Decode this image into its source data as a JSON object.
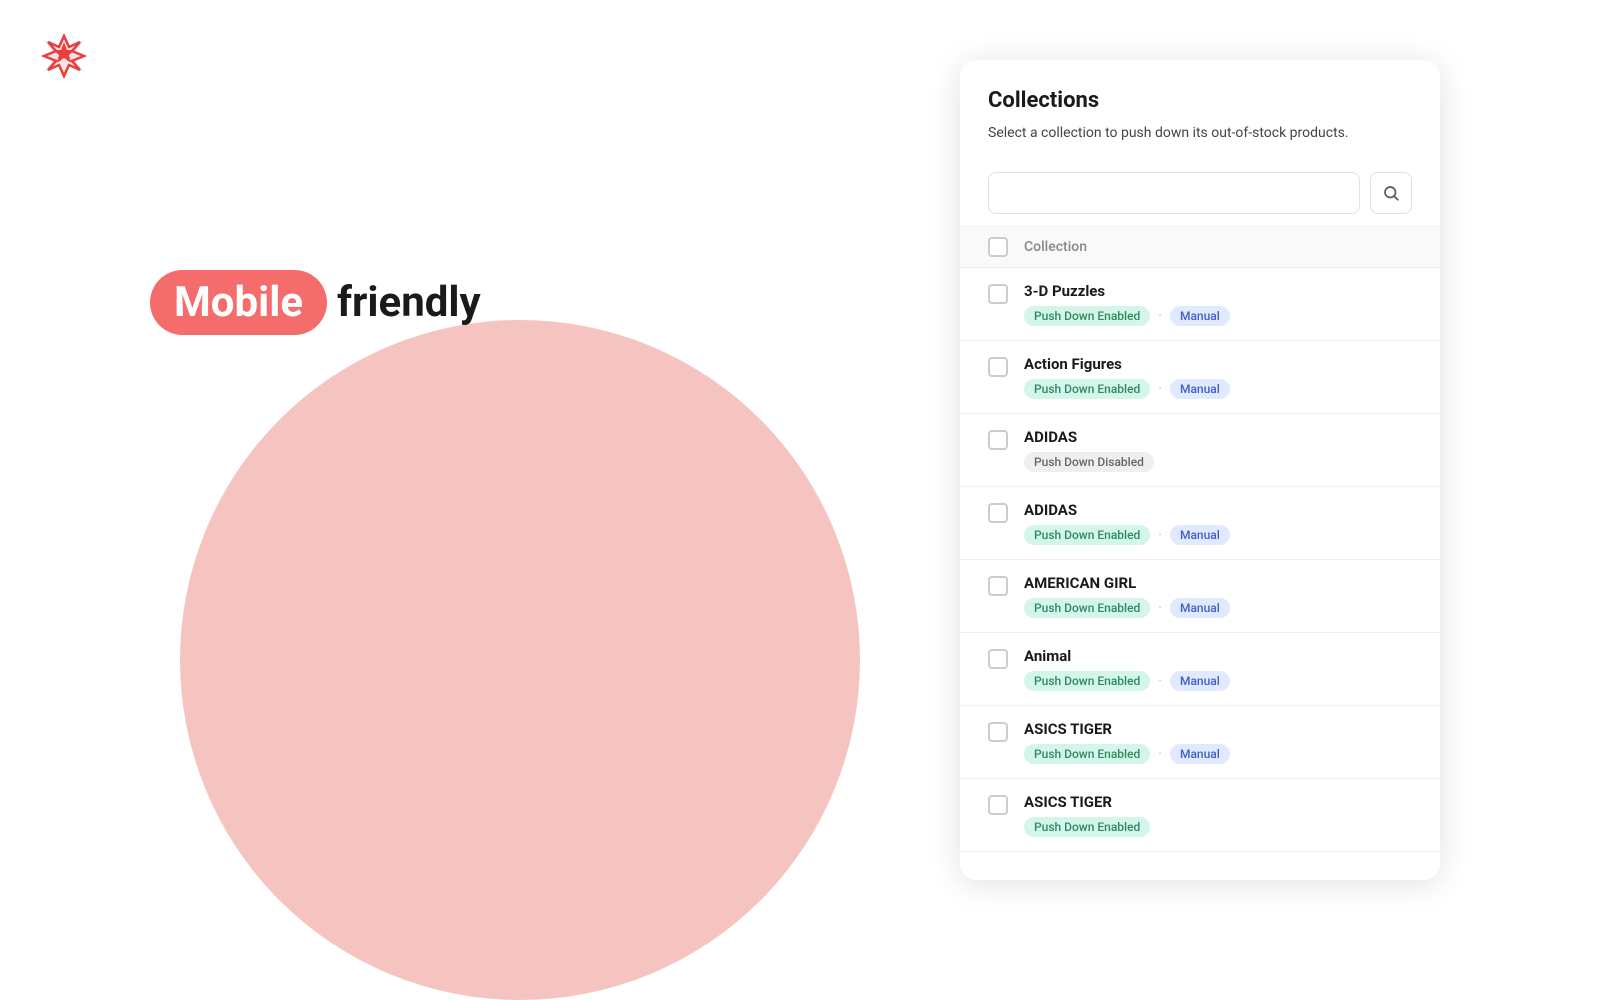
{
  "logo": {
    "alt": "App Logo"
  },
  "hero": {
    "mobile_label": "Mobile",
    "friendly_label": "friendly"
  },
  "panel": {
    "title": "Collections",
    "subtitle": "Select a collection to push down its out-of-stock products.",
    "search_placeholder": "",
    "table_header": "Collection",
    "collections": [
      {
        "id": 1,
        "name": "3-D Puzzles",
        "push_down": "Push Down Enabled",
        "push_down_type": "green",
        "mode": "Manual",
        "mode_type": "blue"
      },
      {
        "id": 2,
        "name": "Action Figures",
        "push_down": "Push Down Enabled",
        "push_down_type": "green",
        "mode": "Manual",
        "mode_type": "blue"
      },
      {
        "id": 3,
        "name": "ADIDAS",
        "push_down": "Push Down Disabled",
        "push_down_type": "gray",
        "mode": null,
        "mode_type": null
      },
      {
        "id": 4,
        "name": "ADIDAS",
        "push_down": "Push Down Enabled",
        "push_down_type": "green",
        "mode": "Manual",
        "mode_type": "blue"
      },
      {
        "id": 5,
        "name": "AMERICAN GIRL",
        "push_down": "Push Down Enabled",
        "push_down_type": "green",
        "mode": "Manual",
        "mode_type": "blue"
      },
      {
        "id": 6,
        "name": "Animal",
        "push_down": "Push Down Enabled",
        "push_down_type": "green",
        "mode": "Manual",
        "mode_type": "blue"
      },
      {
        "id": 7,
        "name": "ASICS TIGER",
        "push_down": "Push Down Enabled",
        "push_down_type": "green",
        "mode": "Manual",
        "mode_type": "blue"
      },
      {
        "id": 8,
        "name": "ASICS TIGER",
        "push_down": "Push Down Enabled",
        "push_down_type": "green",
        "mode": null,
        "mode_type": null
      }
    ],
    "search_icon": "🔍"
  }
}
